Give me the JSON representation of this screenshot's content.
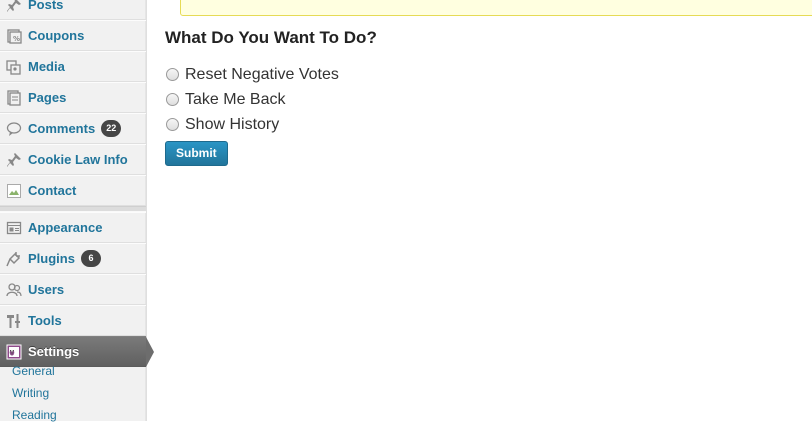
{
  "sidebar": {
    "items": [
      {
        "label": "Posts",
        "icon": "pushpin-icon"
      },
      {
        "label": "Coupons",
        "icon": "coupon-icon"
      },
      {
        "label": "Media",
        "icon": "media-icon"
      },
      {
        "label": "Pages",
        "icon": "pages-icon"
      },
      {
        "label": "Comments",
        "icon": "comment-icon",
        "badge": "22"
      },
      {
        "label": "Cookie Law Info",
        "icon": "pushpin-icon"
      },
      {
        "label": "Contact",
        "icon": "broken-image-icon"
      },
      {
        "label": "Appearance",
        "icon": "appearance-icon"
      },
      {
        "label": "Plugins",
        "icon": "plugin-icon",
        "badge": "6"
      },
      {
        "label": "Users",
        "icon": "users-icon"
      },
      {
        "label": "Tools",
        "icon": "tools-icon"
      },
      {
        "label": "Settings",
        "icon": "settings-icon",
        "current": true
      }
    ],
    "submenu": [
      "General",
      "Writing",
      "Reading"
    ]
  },
  "main": {
    "heading": "What Do You Want To Do?",
    "options": [
      "Reset Negative Votes",
      "Take Me Back",
      "Show History"
    ],
    "submit_label": "Submit"
  },
  "colors": {
    "link": "#21759b",
    "current_bg": "#6d6d6d",
    "button": "#21759b",
    "notice_bg": "#ffffe0"
  }
}
